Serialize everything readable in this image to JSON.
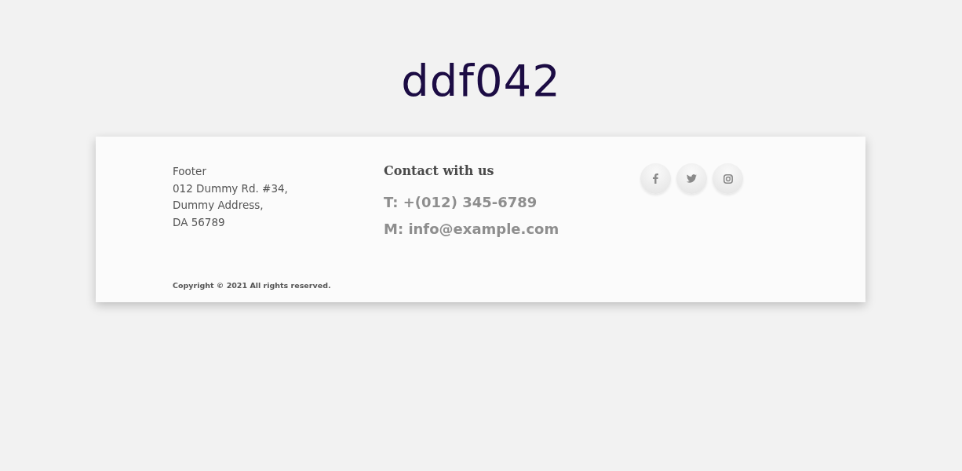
{
  "heading": "ddf042",
  "footer": {
    "address_lines": [
      "Footer",
      "012 Dummy Rd. #34,",
      "Dummy Address,",
      "DA 56789"
    ],
    "contact": {
      "title": "Contact with us",
      "phone": "T: +(012) 345-6789",
      "email": "M: info@example.com"
    },
    "social": [
      {
        "kind": "facebook"
      },
      {
        "kind": "twitter"
      },
      {
        "kind": "instagram"
      }
    ],
    "copyright": "Copyright © 2021 All rights reserved."
  }
}
